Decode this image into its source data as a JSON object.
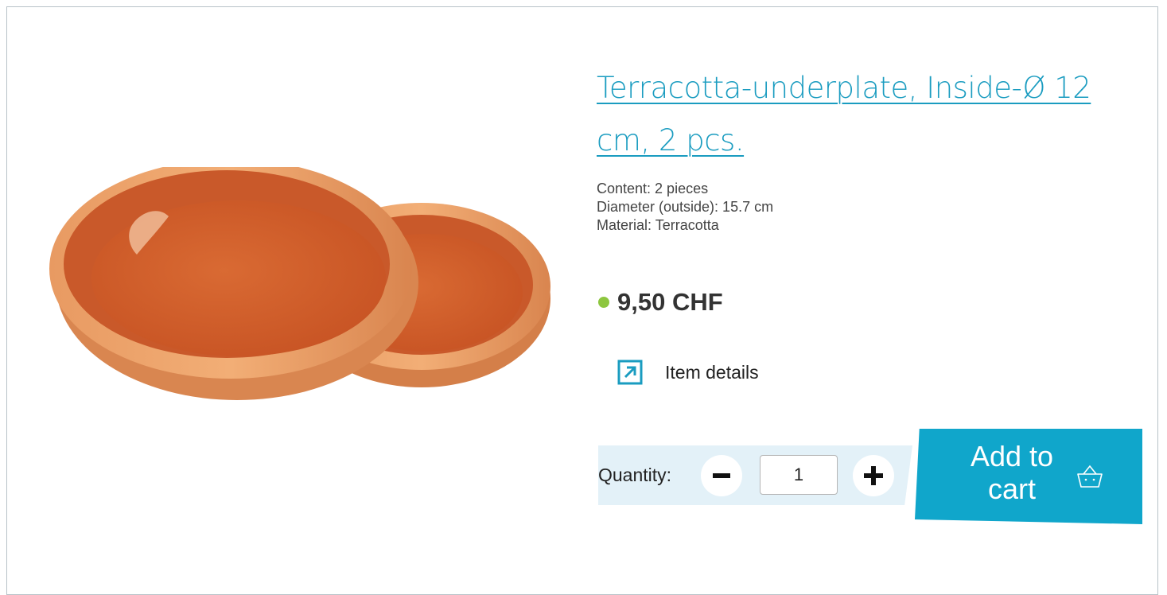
{
  "product": {
    "title": "Terracotta-underplate, Inside-Ø 12 cm, 2 pcs.",
    "image_alt": "Two terracotta underplates",
    "specs": [
      "Content: 2 pieces",
      "Diameter (outside): 15.7 cm",
      "Material: Terracotta"
    ],
    "price": "9,50 CHF",
    "details_label": "Item details"
  },
  "quantity": {
    "label": "Quantity:",
    "value": "1"
  },
  "cart": {
    "button_label": "Add to cart"
  },
  "icons": {
    "external": "external-link-icon",
    "minus": "minus-icon",
    "plus": "plus-icon",
    "basket": "basket-icon"
  },
  "colors": {
    "accent": "#10a6cb",
    "title": "#1a9cc0",
    "availability": "#8dc63f",
    "quantity_bg": "#e3f1f8"
  }
}
